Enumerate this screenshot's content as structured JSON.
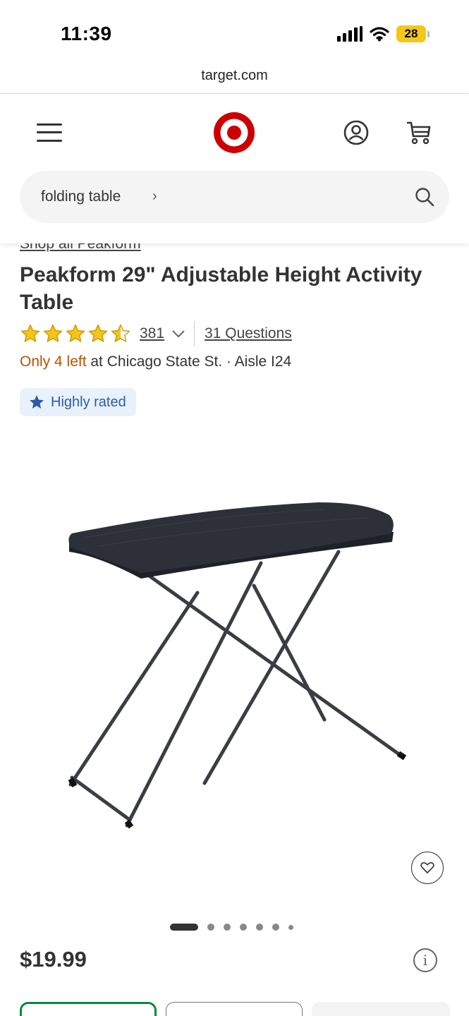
{
  "status_bar": {
    "time": "11:39",
    "battery": "28"
  },
  "browser": {
    "url": "target.com"
  },
  "search": {
    "query": "folding table",
    "chevron": "›"
  },
  "product": {
    "shop_all_link": "Shop all Peakform",
    "title": "Peakform 29\" Adjustable Height Activity Table",
    "rating": 4.5,
    "review_count": "381",
    "questions": "31 Questions",
    "stock_alert": "Only 4 left",
    "stock_location": " at Chicago State St. · Aisle I24",
    "badge": "Highly rated",
    "price": "$19.99",
    "info_glyph": "i"
  },
  "carousel": {
    "total_dots": 7,
    "active_index": 0
  },
  "colors": {
    "brand_red": "#cc0000",
    "star_gold": "#f7c21a",
    "stock_orange": "#b85300",
    "badge_blue": "#2c5ca8",
    "selected_green": "#0a8a3a"
  },
  "icons": [
    "menu-icon",
    "target-logo",
    "account-icon",
    "cart-icon",
    "search-icon",
    "star-icon",
    "chevron-down-icon",
    "heart-icon",
    "info-icon"
  ]
}
